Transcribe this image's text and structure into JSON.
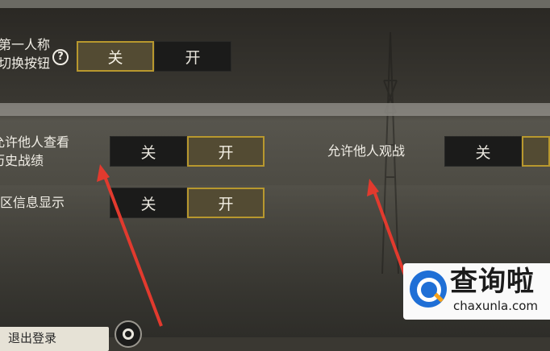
{
  "settings": {
    "first_person_switch": {
      "label_line1": "第一人称",
      "label_line2": "切换按钮",
      "off": "关",
      "on": "开",
      "selected": "off"
    },
    "allow_view_history": {
      "label_line1": "允许他人查看",
      "label_line2": "历史战绩",
      "off": "关",
      "on": "开",
      "selected": "on"
    },
    "allow_spectate": {
      "label": "允许他人观战",
      "off": "关",
      "on": "开",
      "selected": "on"
    },
    "region_info": {
      "label": "战区信息显示",
      "off": "关",
      "on": "开",
      "selected": "on"
    },
    "help_icon_glyph": "?"
  },
  "footer": {
    "logout_label": "退出登录"
  },
  "watermark": {
    "brand": "查询啦",
    "domain": "chaxunla.com"
  },
  "colors": {
    "selected_border": "#b8982e",
    "arrow": "#e23a2e"
  }
}
